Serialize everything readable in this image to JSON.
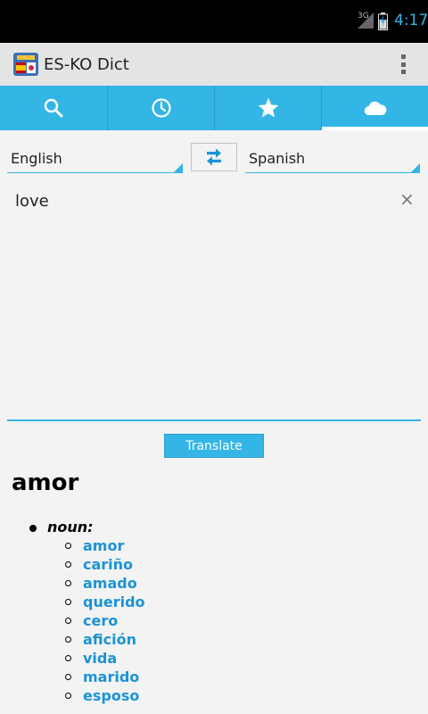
{
  "status_bar": {
    "network": "3G",
    "time": "4:17"
  },
  "action_bar": {
    "title": "ES-KO Dict"
  },
  "tabs": [
    {
      "id": "search",
      "icon": "search-icon"
    },
    {
      "id": "history",
      "icon": "clock-icon"
    },
    {
      "id": "favorites",
      "icon": "star-icon"
    },
    {
      "id": "online",
      "icon": "cloud-icon",
      "selected": true
    }
  ],
  "translator": {
    "source_language": "English",
    "target_language": "Spanish",
    "input_text": "love",
    "clear_symbol": "×",
    "translate_label": "Translate"
  },
  "result": {
    "word": "amor",
    "part_of_speech": "noun:",
    "meanings": [
      "amor",
      "cariño",
      "amado",
      "querido",
      "cero",
      "afición",
      "vida",
      "marido",
      "esposo"
    ]
  },
  "colors": {
    "accent": "#33b5e5",
    "link": "#1a93d6"
  }
}
